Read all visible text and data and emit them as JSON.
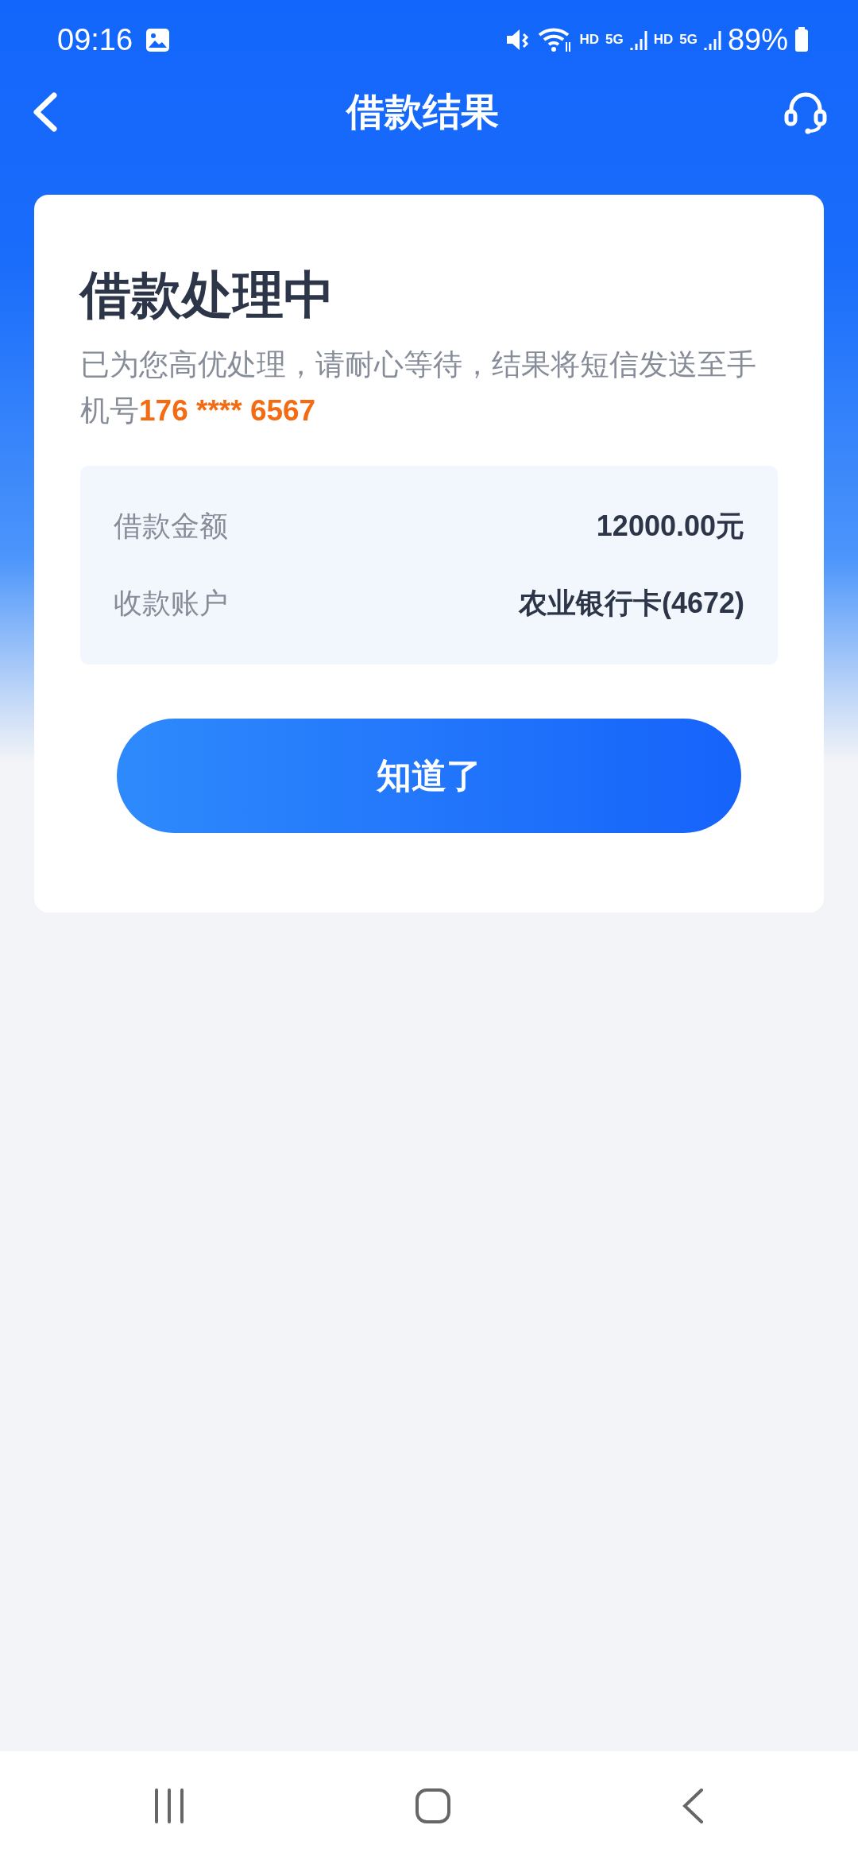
{
  "status_bar": {
    "time": "09:16",
    "network": [
      "HD",
      "5G",
      "HD",
      "5G"
    ],
    "battery": "89%"
  },
  "header": {
    "title": "借款结果"
  },
  "result": {
    "heading": "借款处理中",
    "message": "已为您高优处理，请耐心等待，结果将短信发送至手机号",
    "phone": "176 **** 6567",
    "details": [
      {
        "label": "借款金额",
        "value": "12000.00元"
      },
      {
        "label": "收款账户",
        "value": "农业银行卡(4672)"
      }
    ],
    "button": "知道了"
  }
}
